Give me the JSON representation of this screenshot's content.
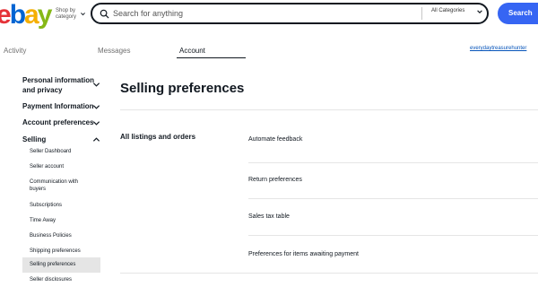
{
  "header": {
    "logo_letters": [
      {
        "char": "e",
        "color": "#e53238"
      },
      {
        "char": "b",
        "color": "#0064d2"
      },
      {
        "char": "a",
        "color": "#f5af02"
      },
      {
        "char": "y",
        "color": "#86b817"
      }
    ],
    "shop_by_line1": "Shop by",
    "shop_by_line2": "category",
    "search_placeholder": "Search for anything",
    "category_selected": "All Categories",
    "search_button": "Search"
  },
  "tabs": {
    "activity": "Activity",
    "messages": "Messages",
    "account": "Account"
  },
  "username": "everydaytreasurehunter",
  "sidebar": {
    "groups": [
      {
        "line1": "Personal information",
        "line2": "and privacy"
      },
      {
        "line1": "Payment Information"
      },
      {
        "line1": "Account preferences"
      },
      {
        "line1": "Selling"
      }
    ],
    "items": [
      {
        "label": "Seller Dashboard"
      },
      {
        "label": "Seller account"
      },
      {
        "label_line1": "Communication with",
        "label_line2": "buyers"
      },
      {
        "label": "Subscriptions"
      },
      {
        "label": "Time Away"
      },
      {
        "label": "Business Policies"
      },
      {
        "label": "Shipping preferences"
      },
      {
        "label": "Selling preferences"
      },
      {
        "label": "Seller disclosures"
      }
    ]
  },
  "main": {
    "title": "Selling preferences",
    "section_title": "All listings and orders",
    "rows": [
      {
        "label": "Automate feedback"
      },
      {
        "label": "Return preferences"
      },
      {
        "label": "Sales tax table"
      },
      {
        "label": "Preferences for items awaiting payment"
      }
    ]
  }
}
